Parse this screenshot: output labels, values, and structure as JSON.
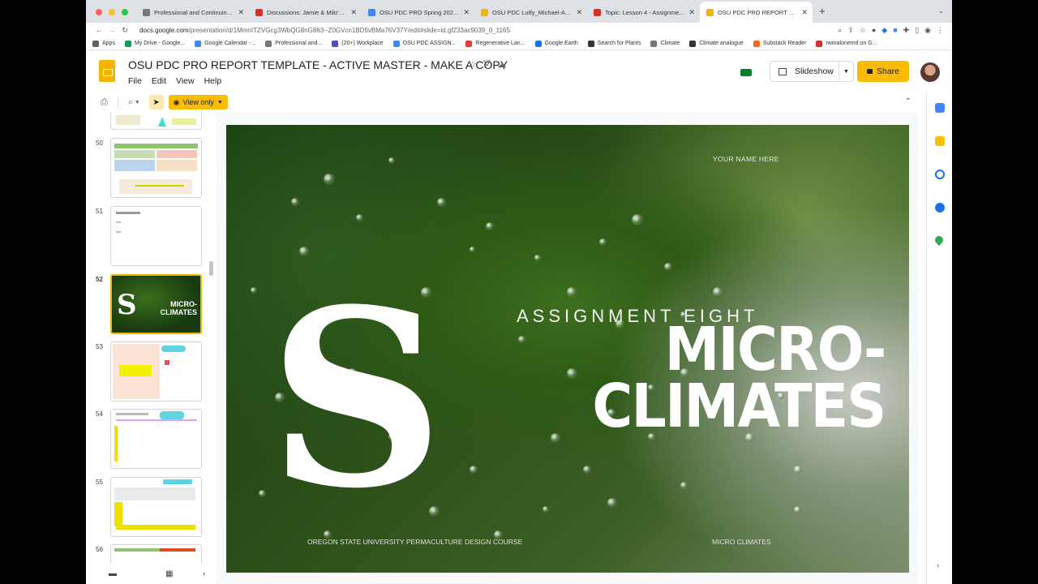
{
  "browser": {
    "tabs": [
      {
        "label": "Professional and Continuing Ed",
        "color": "#777777"
      },
      {
        "label": "Discussions: Jamie & Milo's G",
        "color": "#d93025"
      },
      {
        "label": "OSU PDC PRO Spring 2022 Gr",
        "color": "#4285f4"
      },
      {
        "label": "OSU PDC Lutfy_Michael-Anth",
        "color": "#f4b400"
      },
      {
        "label": "Topic: Lesson 4 - Assignments",
        "color": "#d93025"
      },
      {
        "label": "OSU PDC PRO REPORT TEMP",
        "color": "#f4b400"
      }
    ],
    "url_host": "docs.google.com",
    "url_path": "/presentation/d/1MmnITZVGcg3WbQG8nG863--Z0GVcn1BD5vBMa76V37Y/edit#slide=id.gf233ac9039_0_1165",
    "bookmarks": [
      {
        "label": "Apps",
        "color": "#5f6368"
      },
      {
        "label": "My Drive - Google...",
        "color": "#0f9d58"
      },
      {
        "label": "Google Calendar -...",
        "color": "#4285f4"
      },
      {
        "label": "Professional and...",
        "color": "#777777"
      },
      {
        "label": "(20+) Workplace",
        "color": "#4a4fbf"
      },
      {
        "label": "OSU PDC ASSIGN...",
        "color": "#4285f4"
      },
      {
        "label": "Regenerative Lan...",
        "color": "#e53935"
      },
      {
        "label": "Google Earth",
        "color": "#1a73e8"
      },
      {
        "label": "Search for Plants",
        "color": "#333333"
      },
      {
        "label": "Climate",
        "color": "#777777"
      },
      {
        "label": "Climate analogue",
        "color": "#333333"
      },
      {
        "label": "Substack Reader",
        "color": "#ff6719"
      },
      {
        "label": "rwmalonemd on G...",
        "color": "#d93025"
      }
    ]
  },
  "doc": {
    "title": "OSU PDC PRO REPORT TEMPLATE - ACTIVE MASTER - MAKE A COPY",
    "menus": [
      "File",
      "Edit",
      "View",
      "Help"
    ],
    "slideshow_label": "Slideshow",
    "share_label": "Share",
    "view_only_label": "View only"
  },
  "filmstrip": {
    "slides": [
      {
        "num": "50"
      },
      {
        "num": "51"
      },
      {
        "num": "52"
      },
      {
        "num": "53"
      },
      {
        "num": "54"
      },
      {
        "num": "55"
      },
      {
        "num": "56"
      }
    ],
    "selected": "52"
  },
  "slide": {
    "your_name": "YOUR NAME HERE",
    "assignment": "ASSIGNMENT EIGHT",
    "title_line1": "MICRO-",
    "title_line2": "CLIMATES",
    "number_glyph": "S",
    "footer_left": "OREGON STATE UNIVERSITY PERMACULTURE DESIGN COURSE",
    "footer_right": "MICRO CLIMATES"
  },
  "thumb52": {
    "line1": "MICRO-",
    "line2": "CLIMATES",
    "glyph": "S"
  },
  "colors": {
    "accent": "#fbbc04",
    "slides_brand": "#f4b400"
  }
}
